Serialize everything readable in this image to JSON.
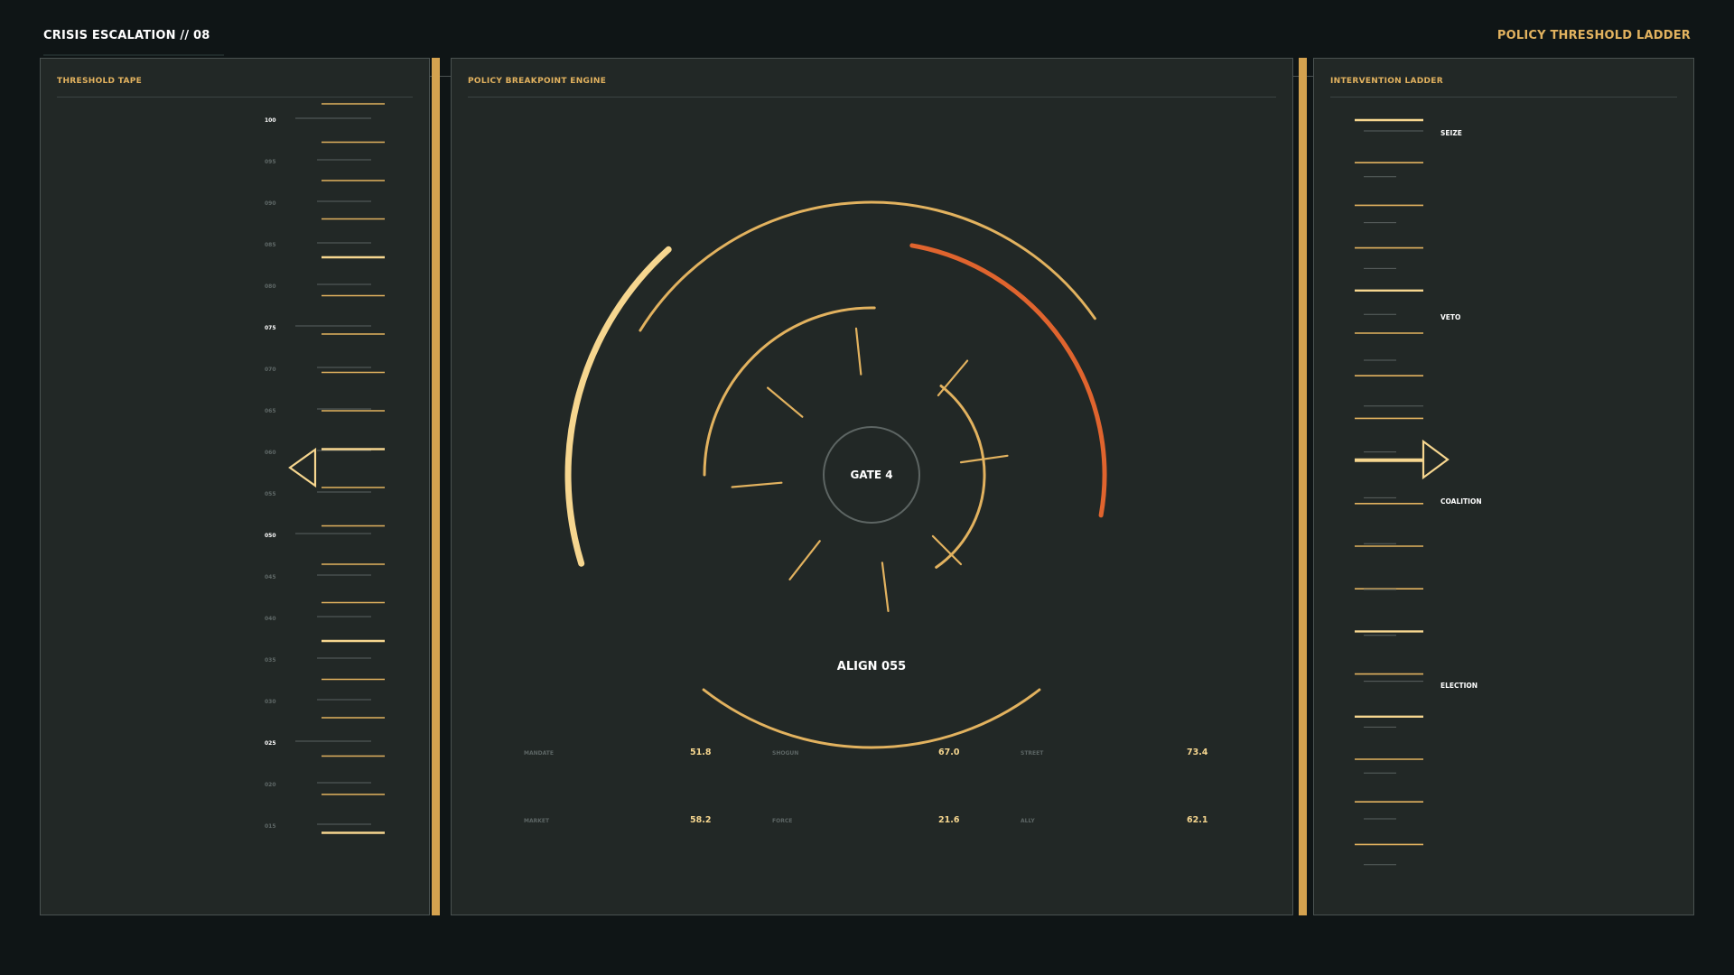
{
  "header": {
    "title": "CRISIS ESCALATION // 08",
    "right_title": "POLICY THRESHOLD LADDER"
  },
  "tape": {
    "title": "THRESHOLD TAPE",
    "labels": [
      "100",
      "095",
      "090",
      "085",
      "080",
      "075",
      "070",
      "065",
      "060",
      "055",
      "050",
      "045",
      "040",
      "035",
      "030",
      "025",
      "020",
      "015"
    ],
    "major": [
      "100",
      "075",
      "050",
      "025"
    ],
    "pointer_value": 60
  },
  "engine": {
    "title": "POLICY BREAKPOINT ENGINE",
    "gate_label": "GATE 4",
    "align_label": "ALIGN 055",
    "metrics": [
      {
        "label": "MANDATE",
        "value": "51.8"
      },
      {
        "label": "SHOGUN",
        "value": "67.0"
      },
      {
        "label": "STREET",
        "value": "73.4"
      },
      {
        "label": "MARKET",
        "value": "58.2"
      },
      {
        "label": "FORCE",
        "value": "21.6"
      },
      {
        "label": "ALLY",
        "value": "62.1"
      }
    ]
  },
  "ladder": {
    "title": "INTERVENTION LADDER",
    "rungs": [
      "SEIZE",
      "VETO",
      "COALITION",
      "ELECTION"
    ]
  },
  "colors": {
    "accent": "#e2b25f",
    "accent_bright": "#f6d68f",
    "hot": "#e0642e",
    "panel": "#222826",
    "background": "#0f1516",
    "muted": "#5f6867"
  }
}
